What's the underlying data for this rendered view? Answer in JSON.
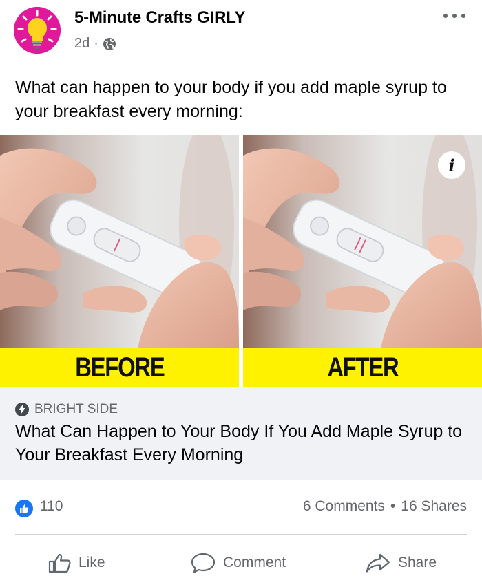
{
  "post": {
    "page_name": "5-Minute Crafts GIRLY",
    "time": "2d",
    "dot": "·",
    "privacy_icon": "globe-icon",
    "text": "What can happen to your body if you add maple syrup to your breakfast every morning:"
  },
  "image": {
    "before_label": "BEFORE",
    "after_label": "AFTER",
    "info_label": "i"
  },
  "link": {
    "source": "BRIGHT SIDE",
    "title": "What Can Happen to Your Body If You Add Maple Syrup to Your Breakfast Every Morning"
  },
  "stats": {
    "likes": "110",
    "comments": "6 Comments",
    "separator": "•",
    "shares": "16 Shares"
  },
  "actions": {
    "like": "Like",
    "comment": "Comment",
    "share": "Share"
  },
  "colors": {
    "accent": "#1877f2",
    "caption_bar": "#fff200",
    "avatar_bg": "#e0189a"
  }
}
